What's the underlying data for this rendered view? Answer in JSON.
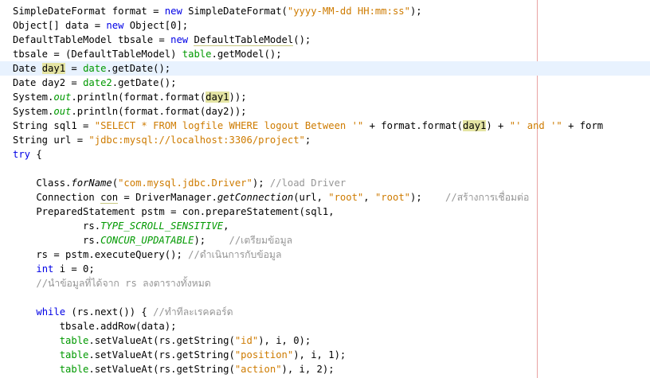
{
  "editor": {
    "lines": [
      {
        "segments": [
          {
            "t": "SimpleDateFormat format = "
          },
          {
            "t": "new",
            "c": "kw"
          },
          {
            "t": " SimpleDateFormat("
          },
          {
            "t": "\"yyyy-MM-dd HH:mm:ss\"",
            "c": "str"
          },
          {
            "t": ");"
          }
        ]
      },
      {
        "segments": [
          {
            "t": "Object[] data = "
          },
          {
            "t": "new",
            "c": "kw"
          },
          {
            "t": " Object[0];"
          }
        ]
      },
      {
        "segments": [
          {
            "t": "DefaultTableModel tbsale = "
          },
          {
            "t": "new",
            "c": "kw"
          },
          {
            "t": " "
          },
          {
            "t": "DefaultTableModel",
            "c": "ul"
          },
          {
            "t": "();"
          }
        ]
      },
      {
        "segments": [
          {
            "t": "tbsale = (DefaultTableModel) "
          },
          {
            "t": "table",
            "c": "field"
          },
          {
            "t": ".getModel();"
          }
        ]
      },
      {
        "current": true,
        "segments": [
          {
            "t": "Date "
          },
          {
            "t": "day1",
            "c": "hl"
          },
          {
            "t": " = "
          },
          {
            "t": "date",
            "c": "field"
          },
          {
            "t": ".getDate();"
          }
        ]
      },
      {
        "segments": [
          {
            "t": "Date day2 = "
          },
          {
            "t": "date2",
            "c": "field"
          },
          {
            "t": ".getDate();"
          }
        ]
      },
      {
        "segments": [
          {
            "t": "System."
          },
          {
            "t": "out",
            "c": "stat"
          },
          {
            "t": ".println(format.format("
          },
          {
            "t": "day1",
            "c": "hl"
          },
          {
            "t": "));"
          }
        ]
      },
      {
        "segments": [
          {
            "t": "System."
          },
          {
            "t": "out",
            "c": "stat"
          },
          {
            "t": ".println(format.format(day2));"
          }
        ]
      },
      {
        "segments": [
          {
            "t": "String sql1 = "
          },
          {
            "t": "\"SELECT * FROM logfile WHERE logout Between '\"",
            "c": "str"
          },
          {
            "t": " + format.format("
          },
          {
            "t": "day1",
            "c": "hl"
          },
          {
            "t": ") + "
          },
          {
            "t": "\"' and '\"",
            "c": "str"
          },
          {
            "t": " + form"
          }
        ]
      },
      {
        "segments": [
          {
            "t": "String url = "
          },
          {
            "t": "\"jdbc:mysql://localhost:3306/project\"",
            "c": "str"
          },
          {
            "t": ";"
          }
        ]
      },
      {
        "segments": [
          {
            "t": "try",
            "c": "kw"
          },
          {
            "t": " {"
          }
        ]
      },
      {
        "segments": []
      },
      {
        "segments": [
          {
            "t": "    Class."
          },
          {
            "t": "forName",
            "c": "ital"
          },
          {
            "t": "("
          },
          {
            "t": "\"com.mysql.jdbc.Driver\"",
            "c": "str"
          },
          {
            "t": "); "
          },
          {
            "t": "//load Driver",
            "c": "cmt"
          }
        ]
      },
      {
        "segments": [
          {
            "t": "    Connection "
          },
          {
            "t": "con",
            "c": "ul"
          },
          {
            "t": " = DriverManager."
          },
          {
            "t": "getConnection",
            "c": "ital"
          },
          {
            "t": "(url, "
          },
          {
            "t": "\"root\"",
            "c": "str"
          },
          {
            "t": ", "
          },
          {
            "t": "\"root\"",
            "c": "str"
          },
          {
            "t": ");    "
          },
          {
            "t": "//สร้างการเชื่อมต่อ",
            "c": "cmt"
          }
        ]
      },
      {
        "segments": [
          {
            "t": "    PreparedStatement pstm = con.prepareStatement(sql1,"
          }
        ]
      },
      {
        "segments": [
          {
            "t": "            rs."
          },
          {
            "t": "TYPE_SCROLL_SENSITIVE",
            "c": "stat"
          },
          {
            "t": ","
          }
        ]
      },
      {
        "segments": [
          {
            "t": "            rs."
          },
          {
            "t": "CONCUR_UPDATABLE",
            "c": "stat"
          },
          {
            "t": ");    "
          },
          {
            "t": "//เตรียมข้อมูล",
            "c": "cmt"
          }
        ]
      },
      {
        "segments": [
          {
            "t": "    rs = pstm.executeQuery(); "
          },
          {
            "t": "//ดำเนินการกับข้อมูล",
            "c": "cmt"
          }
        ]
      },
      {
        "segments": [
          {
            "t": "    "
          },
          {
            "t": "int",
            "c": "kw"
          },
          {
            "t": " i = 0;"
          }
        ]
      },
      {
        "segments": [
          {
            "t": "    "
          },
          {
            "t": "//นำข้อมูลที่ได้จาก rs ลงตารางทั้งหมด",
            "c": "cmt"
          }
        ]
      },
      {
        "segments": []
      },
      {
        "segments": [
          {
            "t": "    "
          },
          {
            "t": "while",
            "c": "kw"
          },
          {
            "t": " (rs.next()) { "
          },
          {
            "t": "//ทำทีละเรคคอร์ด",
            "c": "cmt"
          }
        ]
      },
      {
        "segments": [
          {
            "t": "        tbsale.addRow(data);"
          }
        ]
      },
      {
        "segments": [
          {
            "t": "        "
          },
          {
            "t": "table",
            "c": "field"
          },
          {
            "t": ".setValueAt(rs.getString("
          },
          {
            "t": "\"id\"",
            "c": "str"
          },
          {
            "t": "), i, 0);"
          }
        ]
      },
      {
        "segments": [
          {
            "t": "        "
          },
          {
            "t": "table",
            "c": "field"
          },
          {
            "t": ".setValueAt(rs.getString("
          },
          {
            "t": "\"position\"",
            "c": "str"
          },
          {
            "t": "), i, 1);"
          }
        ]
      },
      {
        "segments": [
          {
            "t": "        "
          },
          {
            "t": "table",
            "c": "field"
          },
          {
            "t": ".setValueAt(rs.getString("
          },
          {
            "t": "\"action\"",
            "c": "str"
          },
          {
            "t": "), i, 2);"
          }
        ]
      }
    ]
  }
}
